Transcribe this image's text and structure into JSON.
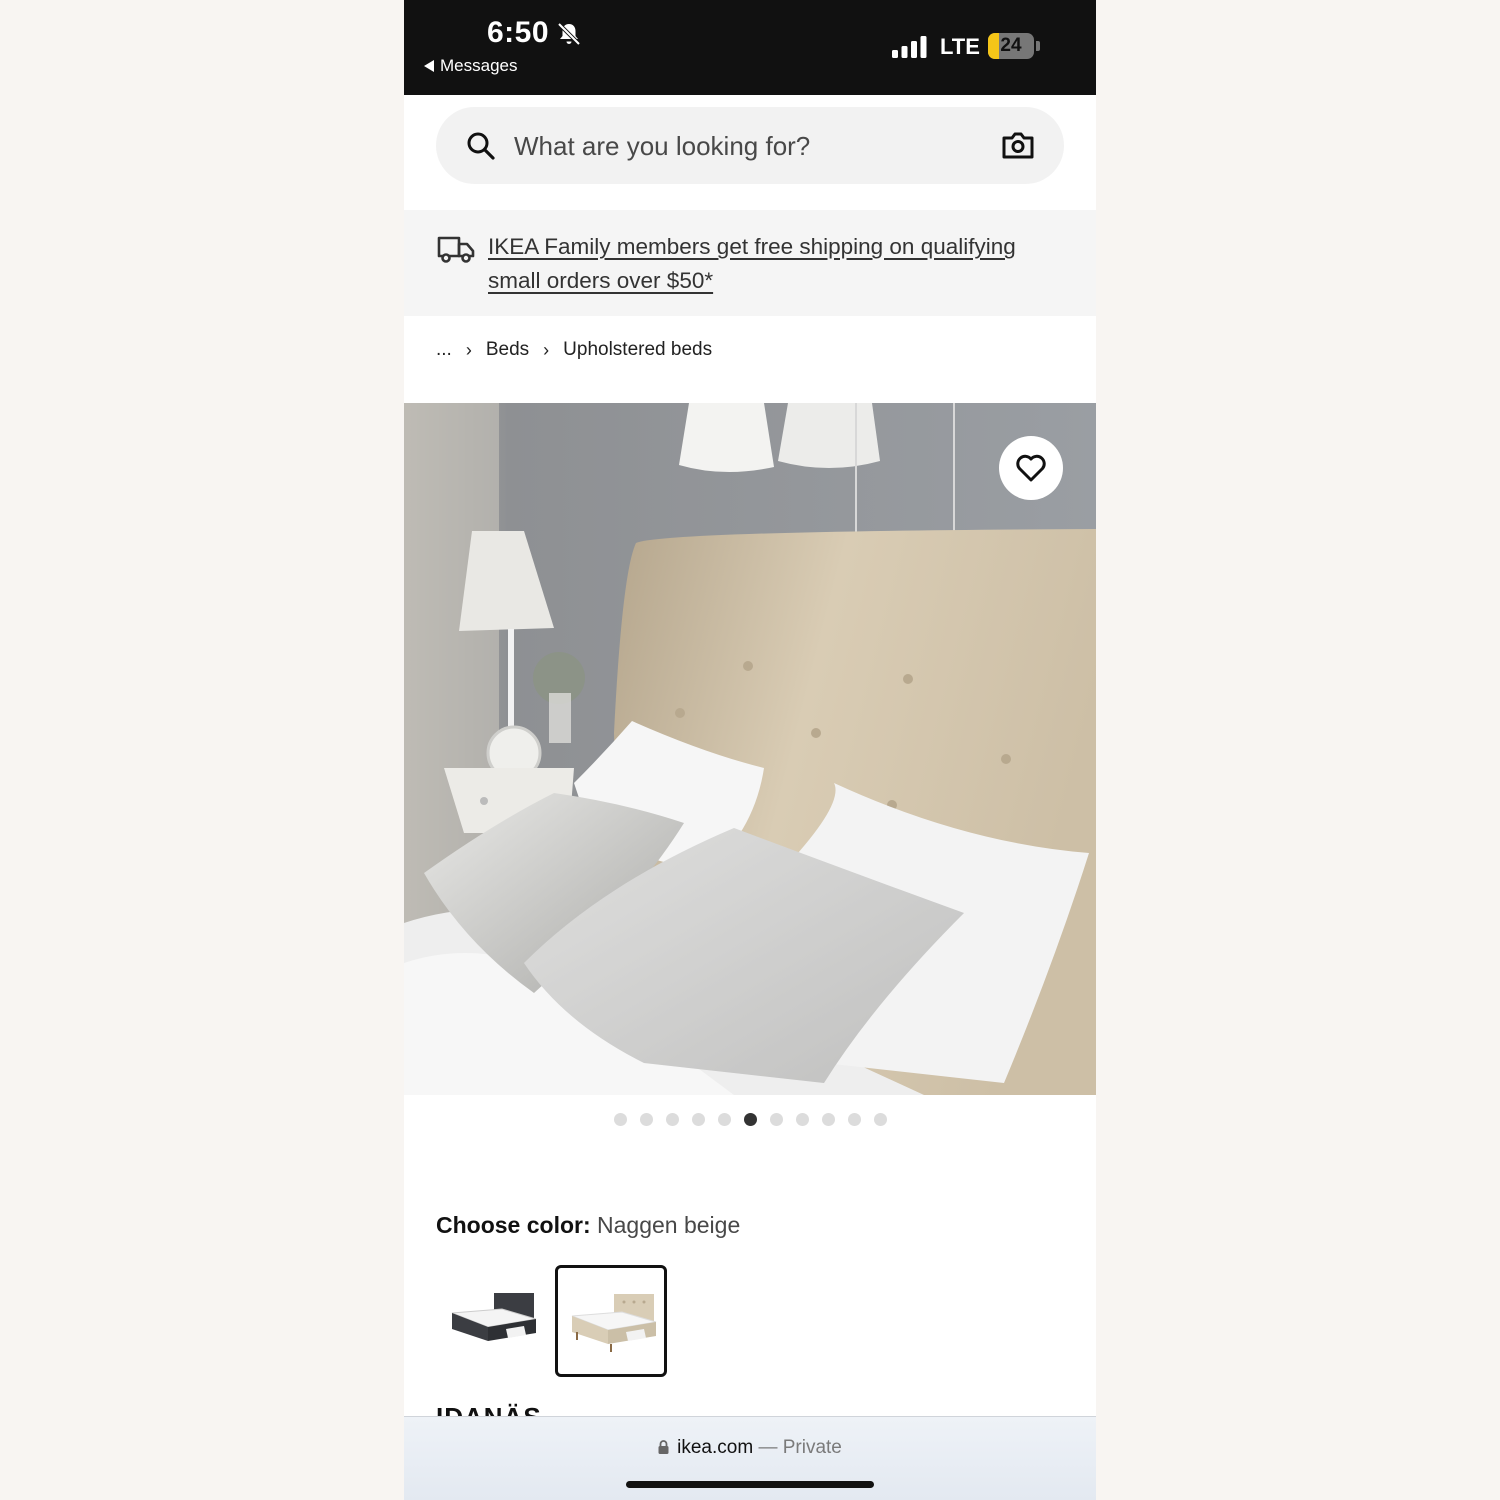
{
  "status_bar": {
    "time": "6:50",
    "back_label": "Messages",
    "network": "LTE",
    "battery_level": "24",
    "battery_fraction": 0.24,
    "bell_icon": "bell-slash-icon"
  },
  "search": {
    "placeholder": "What are you looking for?",
    "search_icon": "search-icon",
    "camera_icon": "camera-icon"
  },
  "banner": {
    "text": "IKEA Family members get free shipping on qualifying small orders over $50*",
    "icon": "truck-icon"
  },
  "breadcrumb": {
    "items": [
      "...",
      "Beds",
      "Upholstered beds"
    ]
  },
  "gallery": {
    "total_images": 11,
    "active_index": 5,
    "favorite_icon": "heart-icon"
  },
  "color_chooser": {
    "label": "Choose color:",
    "selected_value": "Naggen beige",
    "options": [
      {
        "name": "dark-gray",
        "color": "#3b3d42",
        "selected": false
      },
      {
        "name": "beige",
        "color": "#d9cdb6",
        "selected": true
      }
    ]
  },
  "product": {
    "name": "IDANÄS"
  },
  "url_bar": {
    "domain": "ikea.com",
    "separator": "—",
    "mode": "Private"
  },
  "colors": {
    "status_bar_bg": "#111111",
    "battery_yellow": "#f5c518",
    "headboard_beige": "#d8cbb3"
  }
}
